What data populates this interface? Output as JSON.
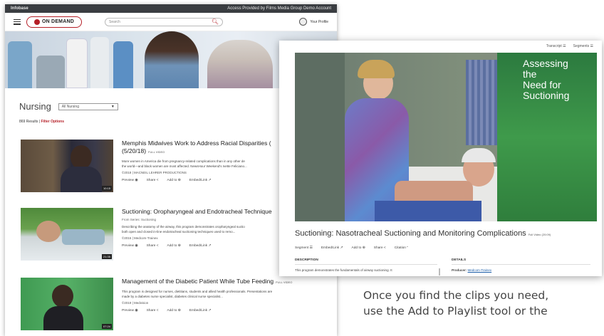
{
  "topbar": {
    "brand": "Infobase",
    "access_text": "Access Provided by Films Media Group Demo Account"
  },
  "header": {
    "logo_top": "FILMS",
    "logo_main": "ON DEMAND",
    "search_placeholder": "Search",
    "profile_label": "Your Profile"
  },
  "catalog": {
    "title": "Nursing",
    "filter_dropdown": "All Nursing",
    "results_count": "869 Results",
    "filter_options": "Filter Options"
  },
  "items": [
    {
      "title": "Memphis Midwives Work to Address Racial Disparities (",
      "title_line2": "(5/20/18)",
      "badge": "FULL VIDEO",
      "description": "More women in America die from pregnancy-related complications than in any other de",
      "description2": "the world—and black women are most affected. NewsHour Weekend's Ivette Feliciano...",
      "producer": "©2018 | MACNEIL LEHRER PRODUCTIONS",
      "duration": "10:15"
    },
    {
      "title": "Suctioning: Oropharyngeal and Endotracheal Technique",
      "series": "From Series: Suctioning",
      "description": "Describing the anatomy of the airway, this program demonstrates oropharyngeal suctio",
      "description2": "both open and closed in-line endotracheal suctioning techniques used to remo...",
      "producer": "©2016 | Medcom-Trainex",
      "duration": "21:35"
    },
    {
      "title": "Management of the Diabetic Patient While Tube Feeding",
      "badge": "FULL VIDEO",
      "description": "This program is designed for nurses, dietitians, students and allied health professionals. Presentations are",
      "description2": "made by a diabetes nurse specialist, diabetes clinical nurse specialist...",
      "producer": "©2019 | Medvision",
      "duration": "07:24"
    }
  ],
  "item_actions": {
    "preview": "Preview ◉",
    "share": "Share <",
    "add_to": "Add to ⊕",
    "embed": "Embed/Link ↗"
  },
  "player": {
    "transcript": "Transcript ☰",
    "segments": "Segments ☰",
    "overlay_title": "Assessing\nthe\nNeed for\nSuctioning",
    "title": "Suctioning: Nasotracheal Suctioning and Monitoring Complications",
    "badge": "Full Video (20:09)",
    "actions": {
      "segment": "Segment ☰",
      "embed": "Embed/Link ↗",
      "add_to": "Add to ⊕",
      "share": "Share <",
      "citation": "Citation ”"
    },
    "description_label": "DESCRIPTION",
    "description_text": "This program demonstrates the fundamentals of airway suctioning. It",
    "details_label": "DETAILS",
    "producer_label": "Producer:",
    "producer_value": "Medcom-Trainex"
  },
  "caption": {
    "line1": "Once you find the clips you need,",
    "line2": "use the Add to Playlist tool or the"
  },
  "colors": {
    "brand_red": "#b51f27",
    "topbar": "#3a3d41",
    "video_green": "#3f9a4b"
  }
}
